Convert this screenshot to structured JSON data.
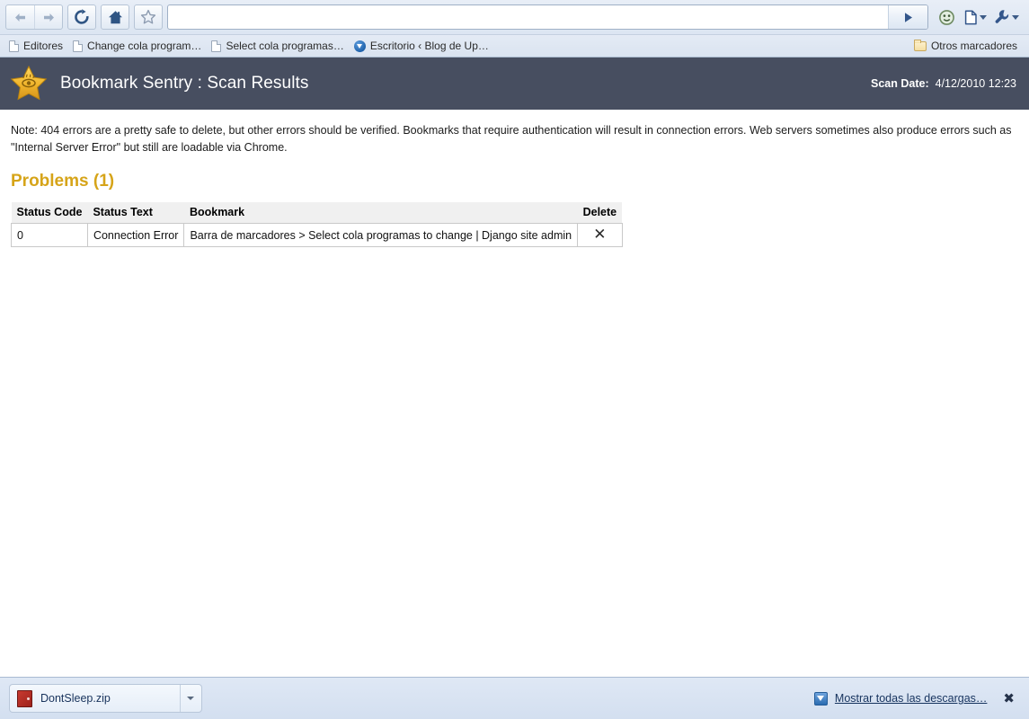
{
  "browser": {
    "back_tooltip": "Back",
    "forward_tooltip": "Forward",
    "reload_tooltip": "Reload",
    "home_tooltip": "Home",
    "bookmark_star_tooltip": "Bookmark this page",
    "address_value": "",
    "address_placeholder": "",
    "go_tooltip": "Go",
    "smiley_tooltip": "Extension",
    "page_menu_tooltip": "Page menu",
    "wrench_menu_tooltip": "Customize and control"
  },
  "bookmarks": {
    "items": [
      {
        "label": "Editores",
        "icon": "page-icon"
      },
      {
        "label": "Change cola program…",
        "icon": "page-icon"
      },
      {
        "label": "Select cola programas…",
        "icon": "page-icon"
      },
      {
        "label": "Escritorio ‹ Blog de Up…",
        "icon": "download-favicon"
      }
    ],
    "other_folder": {
      "label": "Otros marcadores",
      "icon": "folder-icon"
    }
  },
  "app": {
    "title": "Bookmark Sentry : Scan Results",
    "logo": "star-eye-icon",
    "scan_date_label": "Scan Date:",
    "scan_date_value": "4/12/2010 12:23",
    "header_bg": "#474e60",
    "accent_color": "#d6a419"
  },
  "content": {
    "note": "Note: 404 errors are a pretty safe to delete, but other errors should be verified. Bookmarks that require authentication will result in connection errors. Web servers sometimes also produce errors such as \"Internal Server Error\" but still are loadable via Chrome.",
    "problems_heading": "Problems (1)",
    "table": {
      "columns": [
        "Status Code",
        "Status Text",
        "Bookmark",
        "Delete"
      ],
      "rows": [
        {
          "status_code": "0",
          "status_text": "Connection Error",
          "bookmark": "Barra de marcadores > Select cola programas to change | Django site admin",
          "delete_icon": "✕"
        }
      ]
    }
  },
  "downloads": {
    "item_name": "DontSleep.zip",
    "item_icon": "zip-file-icon",
    "menu_icon": "chevron-down-icon",
    "show_all_label": "Mostrar todas las descargas…",
    "show_all_icon": "download-arrow-icon",
    "close_label": "✖"
  }
}
